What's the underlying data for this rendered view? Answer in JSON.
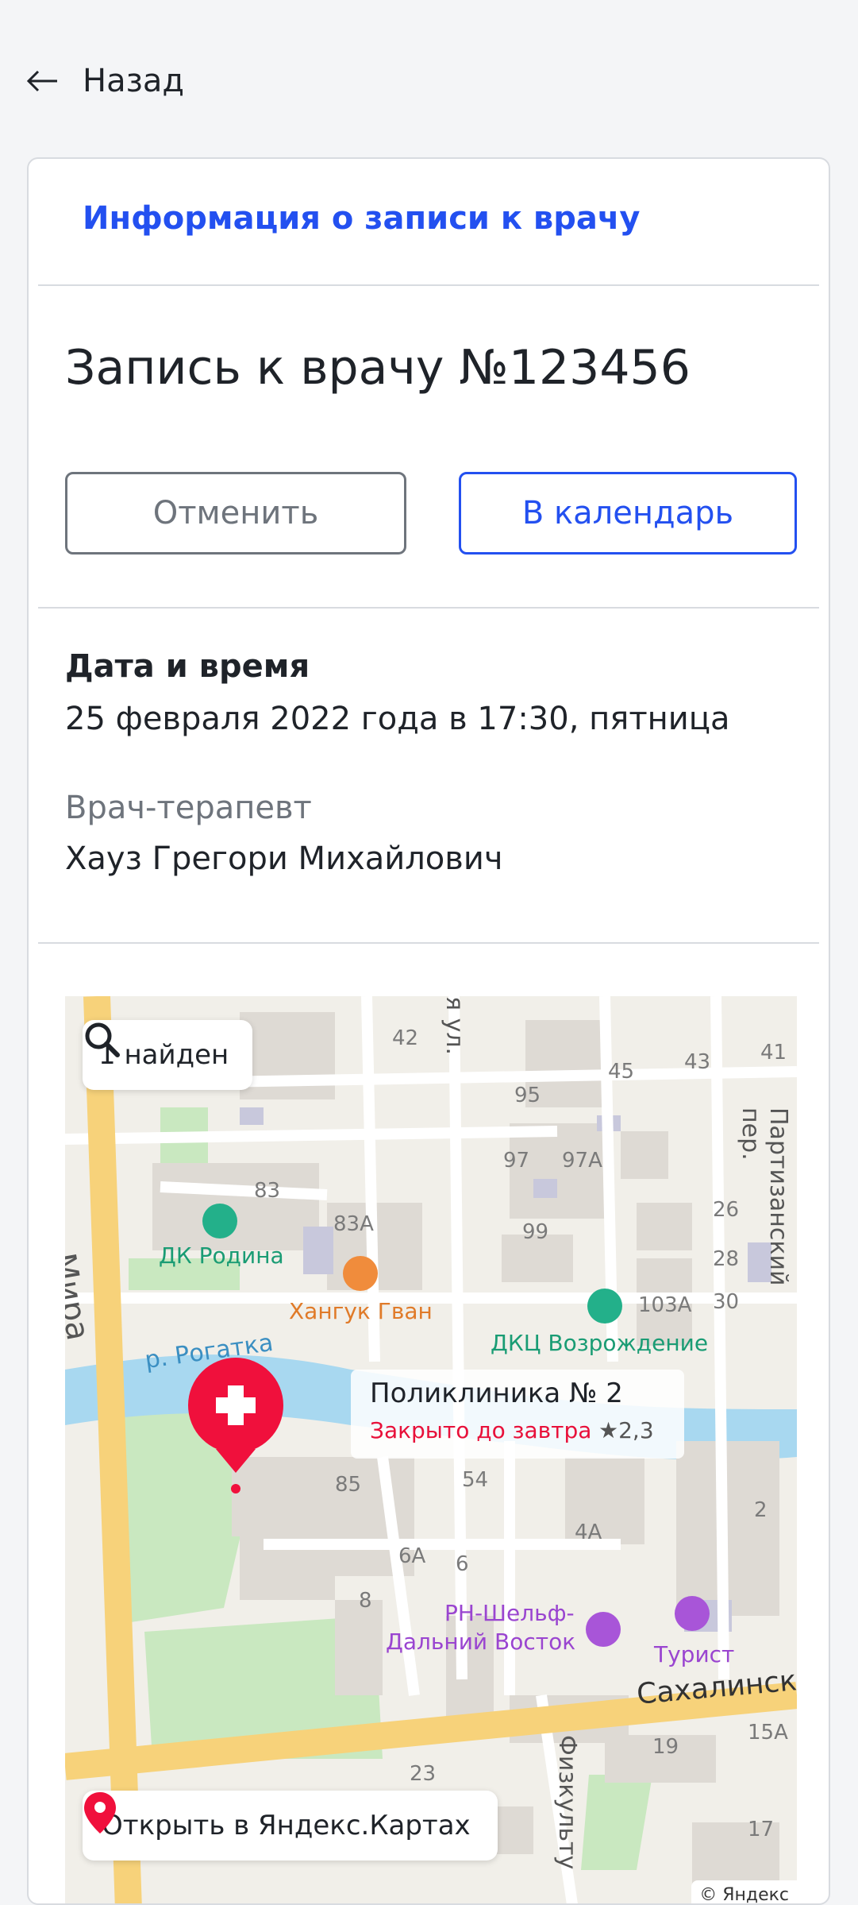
{
  "header": {
    "back_label": "Назад"
  },
  "card": {
    "title": "Информация о записи к врачу",
    "record_title": "Запись к врачу №123456",
    "buttons": {
      "cancel": "Отменить",
      "calendar": "В календарь"
    },
    "datetime_label": "Дата и время",
    "datetime_value": "25 февраля 2022 года в 17:30, пятница",
    "doctor_label": "Врач-терапевт",
    "doctor_name": "Хауз Грегори Михайлович"
  },
  "map": {
    "search_label": "1 найден",
    "open_label": "Открыть в Яндекс.Картах",
    "copyright": "© Яндекс",
    "clinic": {
      "name": "Поликлиника № 2",
      "status": "Закрыто до завтра",
      "rating": "★2,3"
    },
    "streets": [
      "Мира",
      "р. Рогатка",
      "Сахалинск",
      "Партизанский пер.",
      "Физкульту",
      "я ул."
    ],
    "pois": [
      "ДК Родина",
      "Хангук Гван",
      "ДКЦ Возрождение",
      "РН-Шельф-",
      "Дальний Восток",
      "Турист"
    ],
    "house_numbers": [
      "42",
      "45",
      "43",
      "41",
      "95",
      "97",
      "97А",
      "83",
      "83А",
      "99",
      "26",
      "28",
      "30",
      "103А",
      "85",
      "54",
      "4А",
      "2",
      "6А",
      "6",
      "8",
      "19",
      "15А",
      "23",
      "17"
    ],
    "colors": {
      "marker": "#f0103c",
      "water": "#a8d8f0",
      "park": "#c9e8c0",
      "major_road": "#f7d27a",
      "building": "#dedad4"
    }
  }
}
